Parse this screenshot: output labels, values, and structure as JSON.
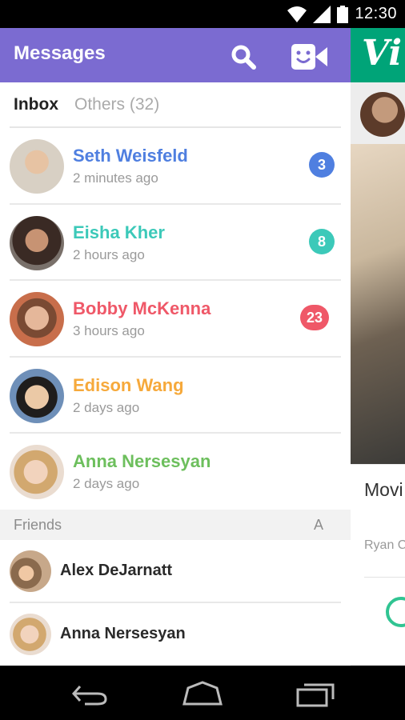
{
  "status_bar": {
    "time": "12:30"
  },
  "app_bar": {
    "title": "Messages"
  },
  "tabs": {
    "inbox": "Inbox",
    "others": "Others (32)"
  },
  "conversations": [
    {
      "name": "Seth Weisfeld",
      "time": "2 minutes ago",
      "badge": "3",
      "color": "#4f7fe0"
    },
    {
      "name": "Eisha Kher",
      "time": "2 hours ago",
      "badge": "8",
      "color": "#3cc9b9"
    },
    {
      "name": "Bobby McKenna",
      "time": "3 hours ago",
      "badge": "23",
      "color": "#ef5868"
    },
    {
      "name": "Edison Wang",
      "time": "2 days ago",
      "badge": "",
      "color": "#f6a93b"
    },
    {
      "name": "Anna Nersesyan",
      "time": "2 days ago",
      "badge": "",
      "color": "#6dbf5d"
    }
  ],
  "friends_section": {
    "title": "Friends",
    "index_letter": "A"
  },
  "friends": [
    {
      "name": "Alex DeJarnatt"
    },
    {
      "name": "Anna Nersesyan"
    }
  ],
  "background_app": {
    "title_partial": "Movi think",
    "author_partial": "Ryan C"
  },
  "colors": {
    "accent": "#7b6bd1",
    "background_header": "#00a478"
  }
}
